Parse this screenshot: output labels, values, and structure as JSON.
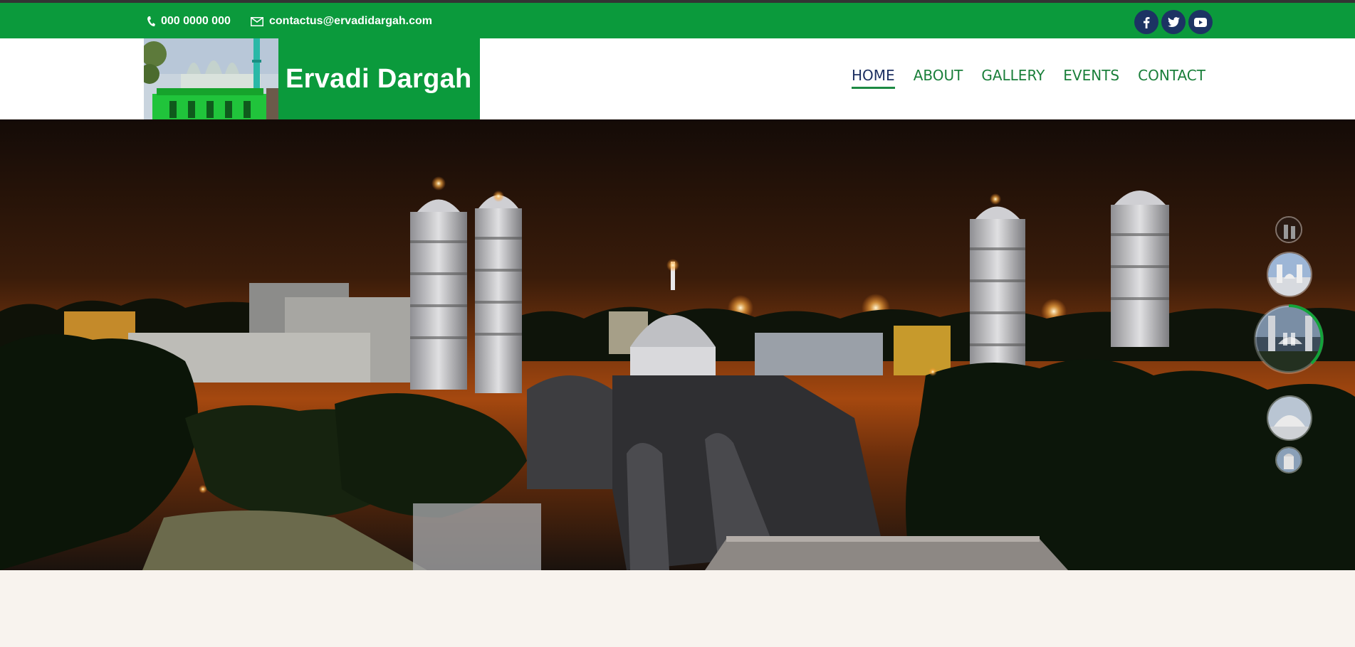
{
  "topbar": {
    "phone": "000 0000 000",
    "email": "contactus@ervadidargah.com",
    "phone_icon": "phone-icon",
    "email_icon": "mail-icon",
    "social": [
      {
        "name": "facebook-icon",
        "label": "f"
      },
      {
        "name": "twitter-icon",
        "label": "t"
      },
      {
        "name": "youtube-icon",
        "label": "y"
      }
    ]
  },
  "header": {
    "logo_text": "Ervadi Dargah",
    "nav": [
      {
        "label": "HOME",
        "active": true
      },
      {
        "label": "ABOUT",
        "active": false
      },
      {
        "label": "GALLERY",
        "active": false
      },
      {
        "label": "EVENTS",
        "active": false
      },
      {
        "label": "CONTACT",
        "active": false
      }
    ]
  },
  "slider": {
    "slides": 5,
    "active_slide": 3,
    "progress": 0.6
  },
  "colors": {
    "brand_green": "#0b9a3c",
    "nav_active": "#1d2f61",
    "social_bg": "#1c3363"
  }
}
